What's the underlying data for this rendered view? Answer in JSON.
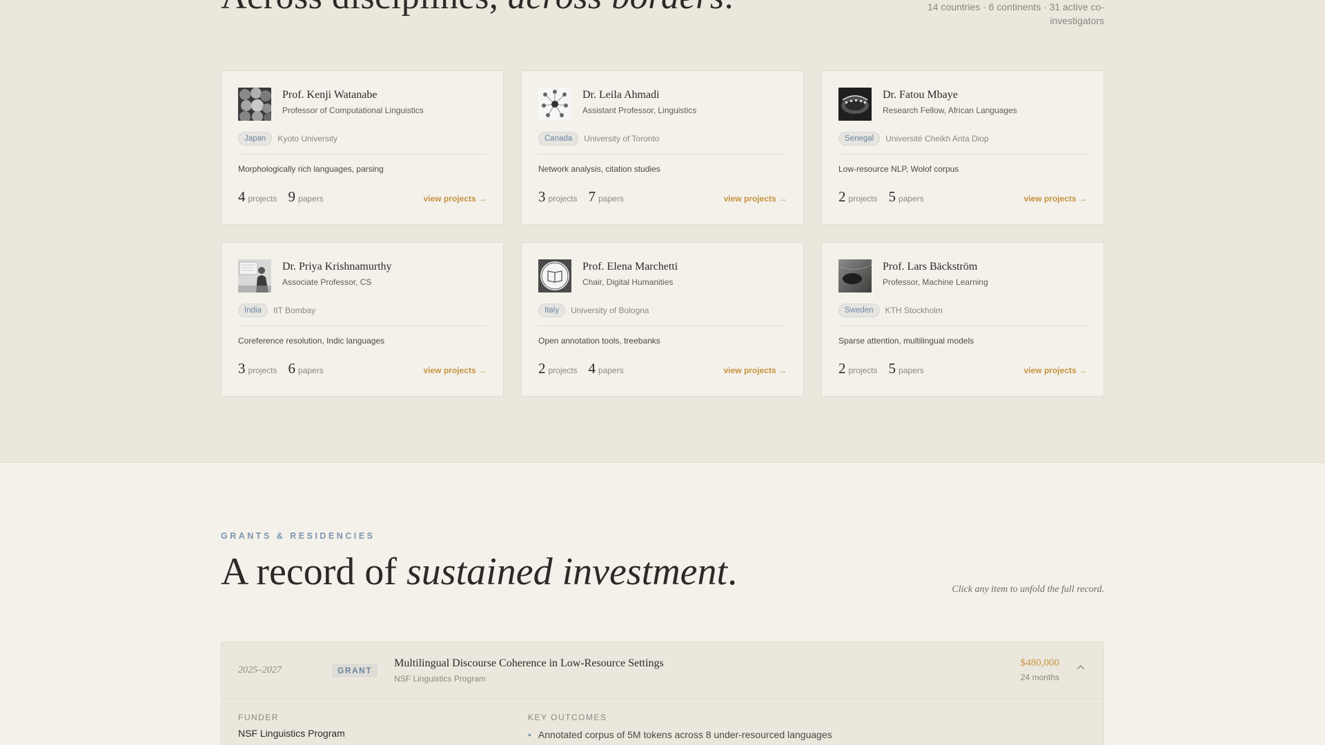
{
  "hero": {
    "title_plain": "Across disciplines, ",
    "title_em": "across borders",
    "title_end": ".",
    "meta": "14 countries · 6 continents · 31 active co-investigators"
  },
  "cards": [
    {
      "name": "Prof. Kenji Watanabe",
      "role": "Professor of Computational Linguistics",
      "country": "Japan",
      "institution": "Kyoto University",
      "focus": "Morphologically rich languages, parsing",
      "projects": "4",
      "projects_label": "projects",
      "papers": "9",
      "papers_label": "papers",
      "link": "view projects →",
      "avatar_icon": "flower-photo"
    },
    {
      "name": "Dr. Leila Ahmadi",
      "role": "Assistant Professor, Linguistics",
      "country": "Canada",
      "institution": "University of Toronto",
      "focus": "Network analysis, citation studies",
      "projects": "3",
      "projects_label": "projects",
      "papers": "7",
      "papers_label": "papers",
      "link": "view projects →",
      "avatar_icon": "network-diagram"
    },
    {
      "name": "Dr. Fatou Mbaye",
      "role": "Research Fellow, African Languages",
      "country": "Senegal",
      "institution": "Université Cheikh Anta Diop",
      "focus": "Low-resource NLP, Wolof corpus",
      "projects": "2",
      "projects_label": "projects",
      "papers": "5",
      "papers_label": "papers",
      "link": "view projects →",
      "avatar_icon": "lecture-hall-photo"
    },
    {
      "name": "Dr. Priya Krishnamurthy",
      "role": "Associate Professor, CS",
      "country": "India",
      "institution": "IIT Bombay",
      "focus": "Coreference resolution, Indic languages",
      "projects": "3",
      "projects_label": "projects",
      "papers": "6",
      "papers_label": "papers",
      "link": "view projects →",
      "avatar_icon": "presenter-photo"
    },
    {
      "name": "Prof. Elena Marchetti",
      "role": "Chair, Digital Humanities",
      "country": "Italy",
      "institution": "University of Bologna",
      "focus": "Open annotation tools, treebanks",
      "projects": "2",
      "projects_label": "projects",
      "papers": "4",
      "papers_label": "papers",
      "link": "view projects →",
      "avatar_icon": "book-logo"
    },
    {
      "name": "Prof. Lars Bäckström",
      "role": "Professor, Machine Learning",
      "country": "Sweden",
      "institution": "KTH Stockholm",
      "focus": "Sparse attention, multilingual models",
      "projects": "2",
      "projects_label": "projects",
      "papers": "5",
      "papers_label": "papers",
      "link": "view projects →",
      "avatar_icon": "abstract-photo"
    }
  ],
  "grants_section": {
    "eyebrow": "GRANTS & RESIDENCIES",
    "title_plain": "A record of ",
    "title_em": "sustained investment",
    "title_end": ".",
    "hint": "Click any item to unfold the full record."
  },
  "grant": {
    "dates": "2025–2027",
    "type": "GRANT",
    "title": "Multilingual Discourse Coherence in Low-Resource Settings",
    "program": "NSF Linguistics Program",
    "amount": "$480,000",
    "duration": "24 months",
    "funder_label": "FUNDER",
    "funder": "NSF Linguistics Program",
    "outcomes_label": "KEY OUTCOMES",
    "outcome_1": "Annotated corpus of 5M tokens across 8 under-resourced languages"
  },
  "colors": {
    "accent": "#c5933d",
    "tag_blue": "#6c86a3",
    "bg": "#ece7dd",
    "card": "#f4f1eb"
  }
}
